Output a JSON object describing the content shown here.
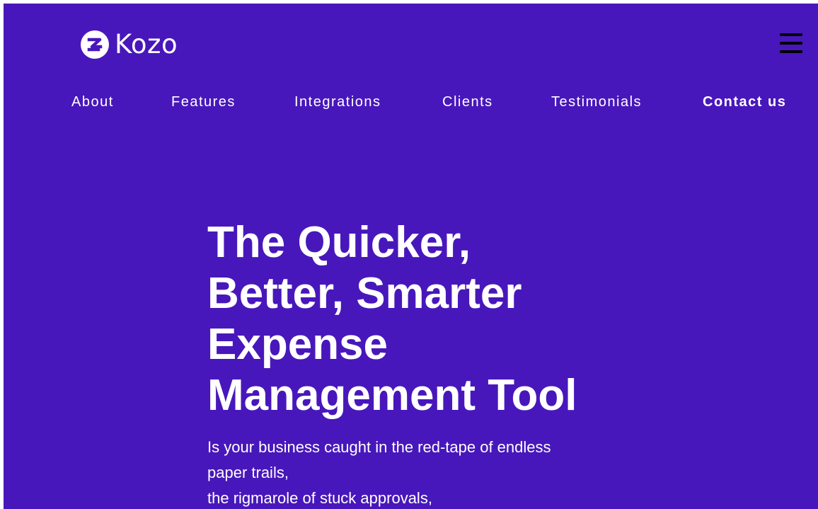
{
  "brand": {
    "name": "Kozo",
    "logo_icon": "kozo-logo-icon",
    "background_color": "#4817bb",
    "text_color": "#ffffff"
  },
  "header": {
    "menu_icon": "hamburger-menu-icon"
  },
  "nav": {
    "items": [
      {
        "label": "About"
      },
      {
        "label": "Features"
      },
      {
        "label": "Integrations"
      },
      {
        "label": "Clients"
      },
      {
        "label": "Testimonials"
      },
      {
        "label": "Contact us"
      }
    ]
  },
  "hero": {
    "title_lines": [
      "The Quicker,",
      "Better, Smarter",
      "Expense",
      "Management Tool"
    ],
    "description_lines": [
      "Is your business caught in the red-tape of endless",
      "paper trails,",
      "the rigmarole of stuck approvals,"
    ]
  }
}
